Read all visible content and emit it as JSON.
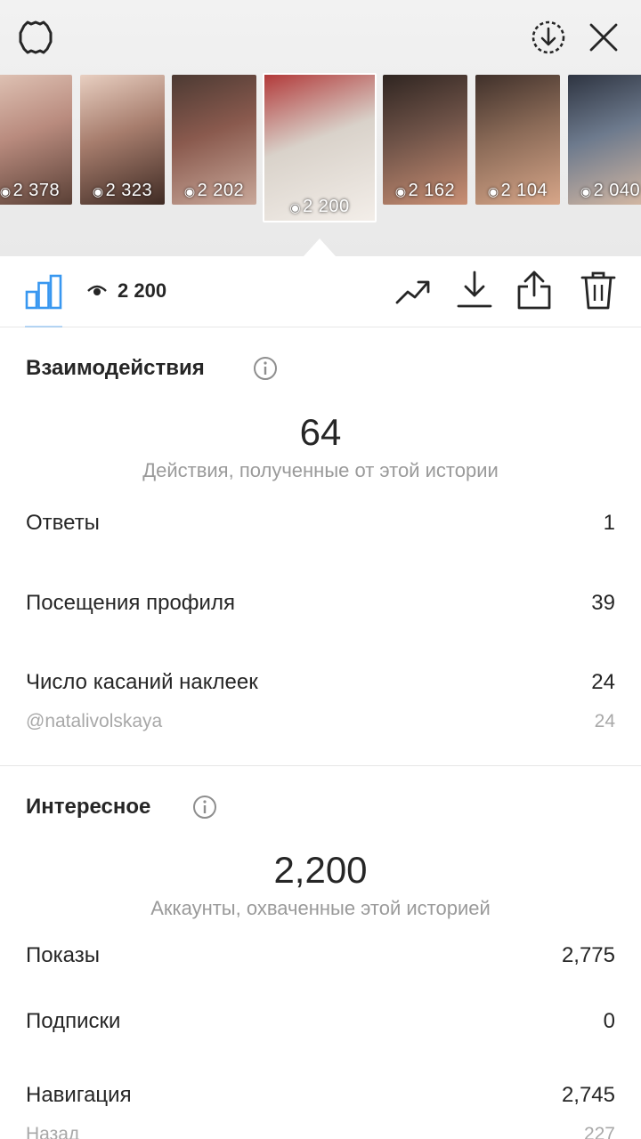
{
  "header": {
    "icons": [
      "settings-icon",
      "download-circle-icon",
      "close-icon"
    ]
  },
  "stories": [
    {
      "views": "2 378",
      "selected": false,
      "colors": [
        "#b98b7e",
        "#5a4036",
        "#e0c4b6"
      ]
    },
    {
      "views": "2 323",
      "selected": false,
      "colors": [
        "#a77d6d",
        "#3f2b24",
        "#e8cfc1"
      ]
    },
    {
      "views": "2 202",
      "selected": false,
      "colors": [
        "#8a5a4e",
        "#c9a89a",
        "#4c3a33"
      ]
    },
    {
      "views": "2 200",
      "selected": true,
      "colors": [
        "#d9d2ca",
        "#f3eee9",
        "#b23a3a"
      ]
    },
    {
      "views": "2 162",
      "selected": false,
      "colors": [
        "#6f5348",
        "#c98f74",
        "#2f2521"
      ]
    },
    {
      "views": "2 104",
      "selected": false,
      "colors": [
        "#8a6a57",
        "#d7a689",
        "#3f302a"
      ]
    },
    {
      "views": "2 040",
      "selected": false,
      "colors": [
        "#6d7a8d",
        "#d6b9a3",
        "#2e3441"
      ]
    }
  ],
  "toolbar": {
    "views_count": "2 200",
    "icons": [
      "bar-chart-icon",
      "eye-icon",
      "trend-icon",
      "save-icon",
      "share-icon",
      "trash-icon"
    ],
    "accent": "#3897f0"
  },
  "interactions": {
    "title": "Взаимодействия",
    "total": "64",
    "caption": "Действия, полученные от этой истории",
    "rows": [
      {
        "label": "Ответы",
        "value": "1"
      },
      {
        "label": "Посещения профиля",
        "value": "39"
      },
      {
        "label": "Число касаний наклеек",
        "value": "24"
      }
    ],
    "sub_rows": [
      {
        "label": "@natalivolskaya",
        "value": "24"
      }
    ]
  },
  "discovery": {
    "title": "Интересное",
    "total": "2,200",
    "caption": "Аккаунты, охваченные этой историей",
    "rows": [
      {
        "label": "Показы",
        "value": "2,775"
      },
      {
        "label": "Подписки",
        "value": "0"
      },
      {
        "label": "Навигация",
        "value": "2,745"
      }
    ],
    "sub_rows": [
      {
        "label": "Назад",
        "value": "227"
      }
    ]
  }
}
